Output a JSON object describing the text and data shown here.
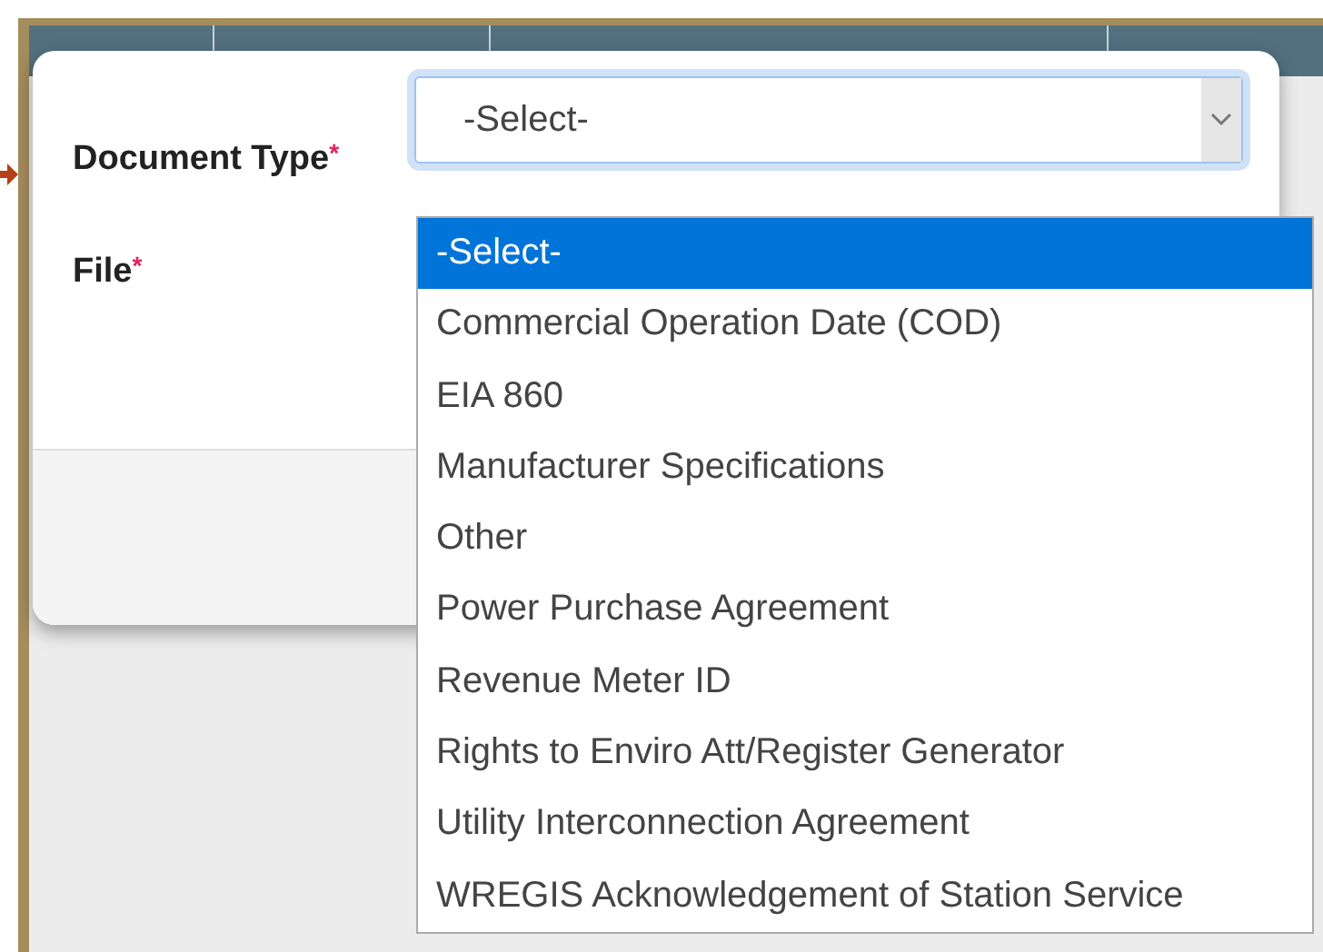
{
  "form": {
    "fields": [
      {
        "kind": "select",
        "label": "Document Type",
        "required_mark": "*",
        "value": "-Select-",
        "expanded": true,
        "options": [
          {
            "label": "-Select-",
            "selected": true
          },
          {
            "label": "Commercial Operation Date (COD)",
            "selected": false
          },
          {
            "label": "EIA 860",
            "selected": false
          },
          {
            "label": "Manufacturer Specifications",
            "selected": false
          },
          {
            "label": "Other",
            "selected": false
          },
          {
            "label": "Power Purchase Agreement",
            "selected": false
          },
          {
            "label": "Revenue Meter ID",
            "selected": false
          },
          {
            "label": "Rights to Enviro Att/Register Generator",
            "selected": false
          },
          {
            "label": "Utility Interconnection Agreement",
            "selected": false
          },
          {
            "label": "WREGIS Acknowledgement of Station Service",
            "selected": false
          }
        ]
      },
      {
        "kind": "file",
        "label": "File",
        "required_mark": "*"
      }
    ]
  }
}
